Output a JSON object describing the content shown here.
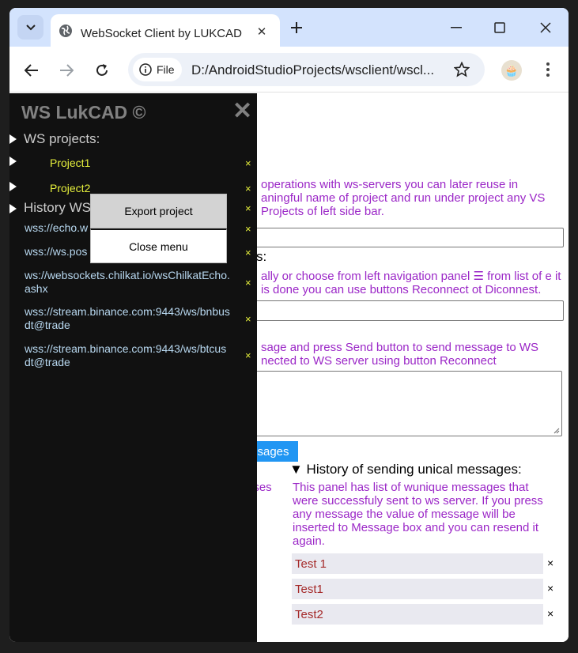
{
  "browser": {
    "tab_title": "WebSocket Client by LUKCAD",
    "file_chip": "File",
    "url": "D:/AndroidStudioProjects/wsclient/wscl..."
  },
  "sidebar": {
    "title": "WS LukCAD ©",
    "close": "✕",
    "projects_heading": "WS projects:",
    "projects": [
      {
        "name": "Project1",
        "remove": "×"
      },
      {
        "name": "Project2",
        "remove": "×"
      }
    ],
    "history_heading": "History WS",
    "history_remove": "×",
    "history": [
      {
        "url": "wss://echo.w",
        "remove": "×"
      },
      {
        "url": "wss://ws.pos",
        "remove": "×"
      },
      {
        "url": "ws://websockets.chilkat.io/wsChilkatEcho.ashx",
        "remove": "×"
      },
      {
        "url": "wss://stream.binance.com:9443/ws/bnbusdt@trade",
        "remove": "×"
      },
      {
        "url": "wss://stream.binance.com:9443/ws/btcusdt@trade",
        "remove": "×"
      }
    ]
  },
  "popup_menu": {
    "export": "Export project",
    "close": "Close menu"
  },
  "main": {
    "hint1": "operations with ws-servers you can later reuse in aningful name of project and run under project any VS Projects of left side bar.",
    "label_s": "s:",
    "hint2": "ally or choose from left navigation panel ☰ from list of e it is done you can use buttons Reconnect ot Diconnest.",
    "hint3": "sage and press Send button to send message to WS nected to WS server using button Reconnect",
    "messages_button": "ssages",
    "responses_fragment": "nses",
    "history_title": "▼ History of sending unical messages:",
    "history_desc": "This panel has list of wunique messages that were successfuly sent to ws server. If you press any message the value of message will be inserted to Message box and you can resend it again.",
    "messages": [
      {
        "text": "Test 1",
        "remove": "×"
      },
      {
        "text": "Test1",
        "remove": "×"
      },
      {
        "text": "Test2",
        "remove": "×"
      }
    ]
  }
}
